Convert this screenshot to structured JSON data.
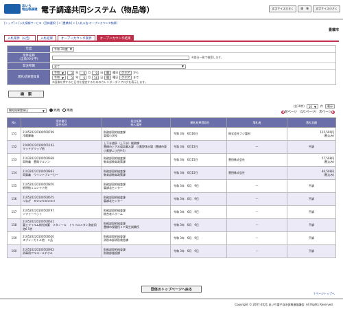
{
  "header": {
    "logo_line1": "あいち",
    "logo_line2": "物品等調達",
    "system_title": "電子調達共同システム（物品等）",
    "buttons": [
      "文字サイズ大きく",
      "標　準",
      "文字サイズ小さく"
    ]
  },
  "breadcrumb": "[トップ] > [入札情報サービス（団体選択）] > [豊橋市] > [入札公告:オープンカウンタ結果]",
  "city": "豊橋市",
  "tabs": [
    {
      "label": "入札案件（公告）",
      "active": false
    },
    {
      "label": "入札結果",
      "active": false
    },
    {
      "label": "オープンカウンタ案件",
      "active": false
    },
    {
      "label": "オープンカウンタ結果",
      "active": true
    }
  ],
  "form": {
    "year_label": "年度",
    "year_value": "令和 3年度",
    "case_label": "案件名称\n(全角30文字)",
    "case_note": "※部分一致で検索します。",
    "dept_label": "発注所属",
    "dept_value": "全て",
    "date_label": "開札結果登録日",
    "date_from": {
      "era": "令和",
      "y": "3",
      "m": "6",
      "d": "9"
    },
    "date_to": {
      "era": "令和",
      "y": "3",
      "m": "6",
      "d": "16"
    },
    "from_suffix": "から",
    "to_suffix": "まで",
    "cal_btn": "暦",
    "clear_btn": "クリア",
    "date_note": "※画像を押すると日付を指定するためのカレンダーダイアログを表示します。",
    "search_btn": "検　索"
  },
  "sort": {
    "select_value": "開札結果登録日",
    "asc_label": "昇順",
    "desc_label": "降順"
  },
  "count": {
    "total": "(全10件)",
    "per_page": "10",
    "unit": "件",
    "show_btn": "表示"
  },
  "pager": {
    "prev": "前ページ",
    "status": "(1/1ページ)",
    "next": "次ページ"
  },
  "table": {
    "headers": [
      "No.",
      "案件番号\n案件名称",
      "発注所属\n納入場所",
      "開札結果登録日",
      "落札者",
      "落札金額"
    ],
    "rows": [
      {
        "no": "151",
        "id": "210520220100500709",
        "name": "冷蔵庫箱",
        "dept": "財務部契約検査課",
        "place": "東陽小学校",
        "date": "令和 3年　6月16日",
        "winner": "株式会社フジ電材",
        "price": "115,500円",
        "price_note": "(税込み)"
      },
      {
        "no": "152",
        "id": "220001220100501103",
        "name": "マッドグリップ他",
        "dept": "上下水道局（上下水）総務課",
        "place": "豊橋市上下水道局事水課　小鷹野浄水場（豊橋市東小鷹野二丁目9-3）",
        "date": "令和 3年　6月15日",
        "winner": "—",
        "price": "不調",
        "price_note": ""
      },
      {
        "no": "153",
        "id": "210320220100500938",
        "name": "両時義　豊岡フルソン",
        "dept": "財務部契約検査課",
        "place": "教育部教育政策課",
        "date": "令和 3年　6月15日",
        "winner": "豊田株式会社",
        "price": "57,508円",
        "price_note": "(税込み)"
      },
      {
        "no": "154",
        "id": "210320220100500863",
        "name": "両員義　ウインドブレーカー",
        "dept": "財務部契約検査課",
        "place": "教育部教育政策課",
        "date": "令和 3年　6月15日",
        "winner": "豊田株式会社",
        "price": "46,508円",
        "price_note": "(税込み)"
      },
      {
        "no": "155",
        "id": "210520220100500870",
        "name": "紙明給１コンテナ他",
        "dept": "財務部契約検査課",
        "place": "雇課北センター",
        "date": "令和 3年　6月　9日",
        "winner": "—",
        "price": "不調",
        "price_note": ""
      },
      {
        "no": "156",
        "id": "210520220100500675",
        "name": "つなぎ　ＲＯＵＮＤＯＮＩ",
        "dept": "財務部契約検査課",
        "place": "雇課北センター",
        "date": "令和 3年　6月　9日",
        "winner": "—",
        "price": "不調",
        "price_note": ""
      },
      {
        "no": "157",
        "id": "210520220100500797",
        "name": "ソファーベット",
        "dept": "財務部契約検査課",
        "place": "総合老人ホーム",
        "date": "令和 3年　6月　9日",
        "winner": "—",
        "price": "不調",
        "price_note": ""
      },
      {
        "no": "158",
        "id": "210520220100500631",
        "name": "富士フイルム和光純薬　メタノール　トリハロメタン測定用　他6 5件",
        "dept": "財務部契約検査課",
        "place": "豊橋市保健所１Ｆ衛生試験所",
        "date": "令和 3年　6月　9日",
        "winner": "—",
        "price": "不調",
        "price_note": ""
      },
      {
        "no": "159",
        "id": "210520220100500620",
        "name": "スプレーガトル他　４品",
        "dept": "財務部契約検査課",
        "place": "消防本部消防救急課",
        "date": "令和 3年　6月　9日",
        "winner": "—",
        "price": "不調",
        "price_note": ""
      },
      {
        "no": "160",
        "id": "210510220100500902",
        "name": "消毒用アルコールチオル",
        "dept": "財務部契約検査課",
        "place": "財務部施設課",
        "date": "令和 3年　6月　9日",
        "winner": "—",
        "price": "不調",
        "price_note": ""
      }
    ]
  },
  "back_btn": "団体のトップページへ戻る",
  "to_top": "↑ページトップへ",
  "copyright": "Copyright © 2007-2021 あいち電子自治体推進協議会. All Rights Reserved."
}
